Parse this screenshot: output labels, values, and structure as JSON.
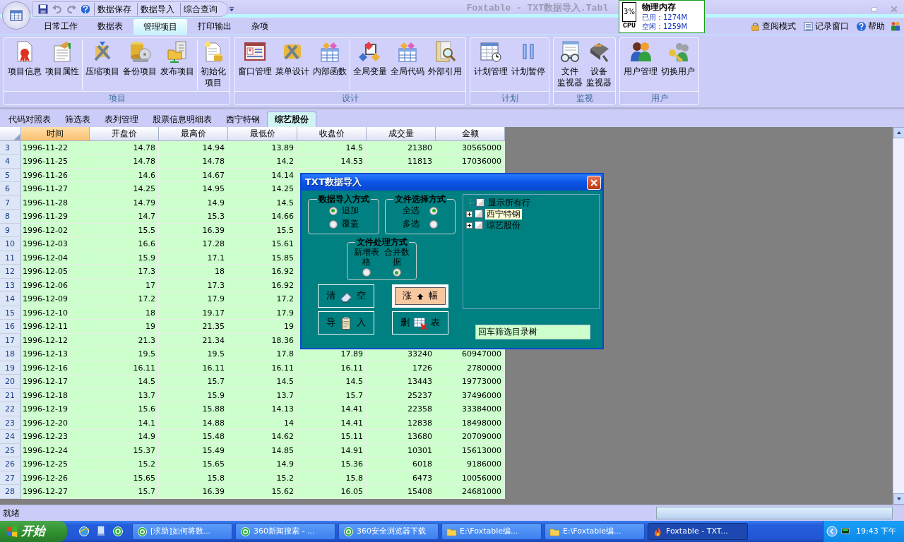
{
  "window": {
    "title": "Foxtable - TXT数据导入.Tabl"
  },
  "quick_access": [
    {
      "label": "数据保存"
    },
    {
      "label": "数据导入"
    },
    {
      "label": "综合查询"
    }
  ],
  "ribbon_tabs": [
    {
      "label": "日常工作",
      "selected": false
    },
    {
      "label": "数据表",
      "selected": false
    },
    {
      "label": "管理项目",
      "selected": true
    },
    {
      "label": "打印输出",
      "selected": false
    },
    {
      "label": "杂项",
      "selected": false
    }
  ],
  "top_links": [
    {
      "label": "查阅模式"
    },
    {
      "label": "记录窗口"
    },
    {
      "label": "帮助"
    }
  ],
  "memory_monitor": {
    "cpu_reading": "3%",
    "cpu_label": "CPU",
    "title": "物理内存",
    "used": "已用：1274M",
    "free": "空闲：1259M"
  },
  "ribbon_groups": [
    {
      "label": "项目",
      "sections": [
        [
          {
            "lines": [
              "项目信息"
            ]
          },
          {
            "lines": [
              "项目属性"
            ]
          }
        ],
        [
          {
            "lines": [
              "压缩项目"
            ]
          },
          {
            "lines": [
              "备份项目"
            ]
          },
          {
            "lines": [
              "发布项目"
            ]
          }
        ],
        [
          {
            "lines": [
              "初始化",
              "项目"
            ]
          }
        ]
      ]
    },
    {
      "label": "设计",
      "sections": [
        [
          {
            "lines": [
              "窗口管理"
            ]
          },
          {
            "lines": [
              "菜单设计"
            ]
          },
          {
            "lines": [
              "内部函数"
            ]
          }
        ],
        [
          {
            "lines": [
              "全局变量"
            ]
          },
          {
            "lines": [
              "全局代码"
            ]
          },
          {
            "lines": [
              "外部引用"
            ]
          }
        ]
      ]
    },
    {
      "label": "计划",
      "sections": [
        [
          {
            "lines": [
              "计划管理"
            ]
          },
          {
            "lines": [
              "计划暂停"
            ]
          }
        ]
      ]
    },
    {
      "label": "监视",
      "sections": [
        [
          {
            "lines": [
              "文件",
              "监视器"
            ]
          },
          {
            "lines": [
              "设备",
              "监视器"
            ]
          }
        ]
      ]
    },
    {
      "label": "用户",
      "sections": [
        [
          {
            "lines": [
              "用户管理"
            ]
          },
          {
            "lines": [
              "切换用户"
            ]
          }
        ]
      ]
    }
  ],
  "table_tabs": [
    {
      "label": "代码对照表",
      "selected": false
    },
    {
      "label": "筛选表",
      "selected": false
    },
    {
      "label": "表列管理",
      "selected": false
    },
    {
      "label": "股票信息明细表",
      "selected": false
    },
    {
      "label": "西宁特钢",
      "selected": false
    },
    {
      "label": "综艺股份",
      "selected": true
    }
  ],
  "grid": {
    "columns": [
      {
        "label": "时间",
        "selected": true
      },
      {
        "label": "开盘价",
        "selected": false
      },
      {
        "label": "最高价",
        "selected": false
      },
      {
        "label": "最低价",
        "selected": false
      },
      {
        "label": "收盘价",
        "selected": false
      },
      {
        "label": "成交量",
        "selected": false
      },
      {
        "label": "金额",
        "selected": false
      }
    ],
    "rows": [
      {
        "number": "3",
        "cells": [
          "1996-11-22",
          "14.78",
          "14.94",
          "13.89",
          "14.5",
          "21380",
          "30565000"
        ]
      },
      {
        "number": "4",
        "cells": [
          "1996-11-25",
          "14.78",
          "14.78",
          "14.2",
          "14.53",
          "11813",
          "17036000"
        ]
      },
      {
        "number": "5",
        "cells": [
          "1996-11-26",
          "14.6",
          "14.67",
          "14.14"
        ]
      },
      {
        "number": "6",
        "cells": [
          "1996-11-27",
          "14.25",
          "14.95",
          "14.25"
        ]
      },
      {
        "number": "7",
        "cells": [
          "1996-11-28",
          "14.79",
          "14.9",
          "14.5"
        ]
      },
      {
        "number": "8",
        "cells": [
          "1996-11-29",
          "14.7",
          "15.3",
          "14.66"
        ]
      },
      {
        "number": "9",
        "cells": [
          "1996-12-02",
          "15.5",
          "16.39",
          "15.5"
        ]
      },
      {
        "number": "10",
        "cells": [
          "1996-12-03",
          "16.6",
          "17.28",
          "15.61"
        ]
      },
      {
        "number": "11",
        "cells": [
          "1996-12-04",
          "15.9",
          "17.1",
          "15.85"
        ]
      },
      {
        "number": "12",
        "cells": [
          "1996-12-05",
          "17.3",
          "18",
          "16.92"
        ]
      },
      {
        "number": "13",
        "cells": [
          "1996-12-06",
          "17",
          "17.3",
          "16.92"
        ]
      },
      {
        "number": "14",
        "cells": [
          "1996-12-09",
          "17.2",
          "17.9",
          "17.2"
        ]
      },
      {
        "number": "15",
        "cells": [
          "1996-12-10",
          "18",
          "19.17",
          "17.9"
        ]
      },
      {
        "number": "16",
        "cells": [
          "1996-12-11",
          "19",
          "21.35",
          "19"
        ]
      },
      {
        "number": "17",
        "cells": [
          "1996-12-12",
          "21.3",
          "21.34",
          "18.36"
        ]
      },
      {
        "number": "18",
        "cells": [
          "1996-12-13",
          "19.5",
          "19.5",
          "17.8",
          "17.89",
          "33240",
          "60947000"
        ]
      },
      {
        "number": "19",
        "cells": [
          "1996-12-16",
          "16.11",
          "16.11",
          "16.11",
          "16.11",
          "1726",
          "2780000"
        ]
      },
      {
        "number": "20",
        "cells": [
          "1996-12-17",
          "14.5",
          "15.7",
          "14.5",
          "14.5",
          "13443",
          "19773000"
        ]
      },
      {
        "number": "21",
        "cells": [
          "1996-12-18",
          "13.7",
          "15.9",
          "13.7",
          "15.7",
          "25237",
          "37496000"
        ]
      },
      {
        "number": "22",
        "cells": [
          "1996-12-19",
          "15.6",
          "15.88",
          "14.13",
          "14.41",
          "22358",
          "33384000"
        ]
      },
      {
        "number": "23",
        "cells": [
          "1996-12-20",
          "14.1",
          "14.88",
          "14",
          "14.41",
          "12838",
          "18498000"
        ]
      },
      {
        "number": "24",
        "cells": [
          "1996-12-23",
          "14.9",
          "15.48",
          "14.62",
          "15.11",
          "13680",
          "20709000"
        ]
      },
      {
        "number": "25",
        "cells": [
          "1996-12-24",
          "15.37",
          "15.49",
          "14.85",
          "14.91",
          "10301",
          "15613000"
        ]
      },
      {
        "number": "26",
        "cells": [
          "1996-12-25",
          "15.2",
          "15.65",
          "14.9",
          "15.36",
          "6018",
          "9186000"
        ]
      },
      {
        "number": "27",
        "cells": [
          "1996-12-26",
          "15.65",
          "15.8",
          "15.2",
          "15.8",
          "6473",
          "10056000"
        ]
      },
      {
        "number": "28",
        "cells": [
          "1996-12-27",
          "15.7",
          "16.39",
          "15.62",
          "16.05",
          "15408",
          "24681000"
        ]
      }
    ]
  },
  "dialog": {
    "title": "TXT数据导入",
    "option_groups": [
      {
        "legend": "数据导入方式",
        "kind": "label-first",
        "options": [
          {
            "label": "追加",
            "selected": true
          },
          {
            "label": "覆盖",
            "selected": false
          }
        ]
      },
      {
        "legend": "文件选择方式",
        "kind": "radio-last",
        "options": [
          {
            "label": "全选",
            "selected": true
          },
          {
            "label": "多选",
            "selected": false
          }
        ]
      },
      {
        "legend": "文件处理方式",
        "kind": "stacked",
        "options": [
          {
            "label": "新增表格",
            "selected": false
          },
          {
            "label": "合并数据",
            "selected": true
          }
        ]
      }
    ],
    "buttons": [
      {
        "left": "清",
        "right": "空",
        "highlighted": false
      },
      {
        "left": "涨",
        "right": "幅",
        "highlighted": true
      },
      {
        "left": "导",
        "right": "入",
        "highlighted": false
      },
      {
        "left": "删",
        "right": "表",
        "highlighted": false
      }
    ],
    "tree": [
      {
        "label": "显示所有行",
        "checked": false,
        "expandable": false,
        "selected": false
      },
      {
        "label": "西宁特钢",
        "checked": false,
        "expandable": true,
        "selected": true
      },
      {
        "label": "综艺股份",
        "checked": false,
        "expandable": true,
        "selected": false
      }
    ],
    "filter_field": {
      "value": "回车筛选目录树"
    }
  },
  "status_bar": {
    "text": "就绪"
  },
  "taskbar": {
    "start": "开始",
    "tasks": [
      {
        "label": "[求助]如何将数...",
        "kind": "browser",
        "selected": false
      },
      {
        "label": "360新闻搜索 - ...",
        "kind": "browser",
        "selected": false
      },
      {
        "label": "360安全浏览器下载",
        "kind": "browser",
        "selected": false
      },
      {
        "label": "E:\\Foxtable编...",
        "kind": "folder",
        "selected": false
      },
      {
        "label": "E:\\Foxtable编...",
        "kind": "folder",
        "selected": false
      },
      {
        "label": "Foxtable - TXT...",
        "kind": "app",
        "selected": true
      }
    ],
    "clock": "19:43 下午"
  }
}
